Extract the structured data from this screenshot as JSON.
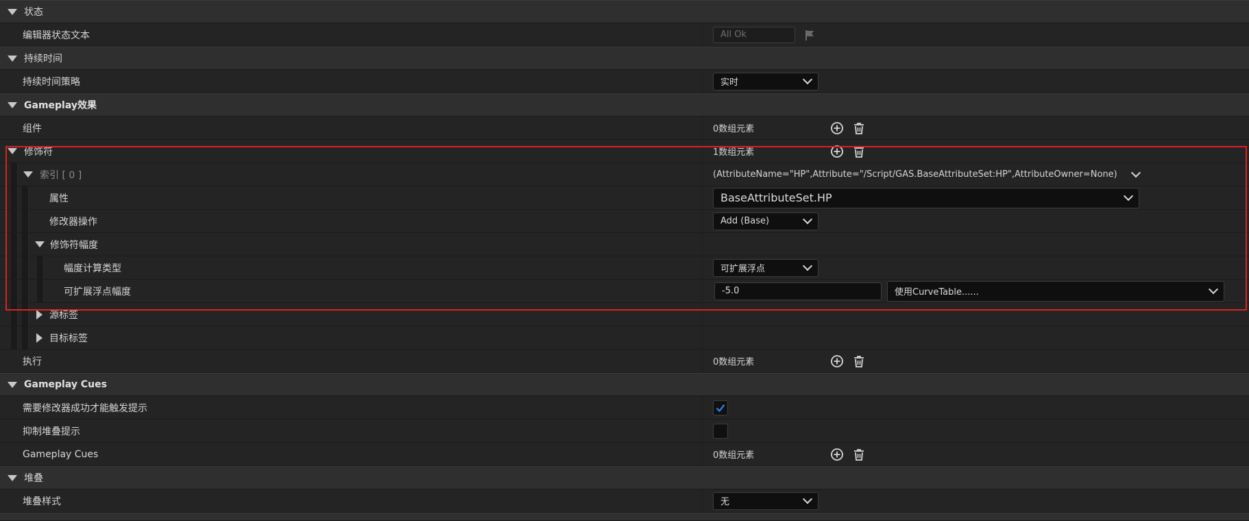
{
  "sections": {
    "state": "状态",
    "duration": "持续时间",
    "gameplay_effect": "Gameplay效果",
    "gameplay_cues": "Gameplay Cues",
    "stacking": "堆叠"
  },
  "rows": {
    "editor_status_text": {
      "label": "编辑器状态文本",
      "value": "All Ok"
    },
    "duration_policy": {
      "label": "持续时间策略",
      "value": "实时"
    },
    "components": {
      "label": "组件",
      "count": "0数组元素"
    },
    "modifiers": {
      "label": "修饰符",
      "count": "1数组元素"
    },
    "index0": {
      "label": "索引 [ 0 ]",
      "value": "(AttributeName=\"HP\",Attribute=\"/Script/GAS.BaseAttributeSet:HP\",AttributeOwner=None)"
    },
    "attribute": {
      "label": "属性",
      "value": "BaseAttributeSet.HP"
    },
    "modifier_op": {
      "label": "修改器操作",
      "value": "Add (Base)"
    },
    "modifier_magnitude": {
      "label": "修饰符幅度"
    },
    "magnitude_calc_type": {
      "label": "幅度计算类型",
      "value": "可扩展浮点"
    },
    "scalable_float_magnitude": {
      "label": "可扩展浮点幅度",
      "value": "-5.0",
      "curve_table": "使用CurveTable......"
    },
    "source_tags": {
      "label": "源标签"
    },
    "target_tags": {
      "label": "目标标签"
    },
    "executions": {
      "label": "执行",
      "count": "0数组元素"
    },
    "require_modifier_success": {
      "label": "需要修改器成功才能触发提示",
      "checked": true
    },
    "suppress_stacking_cues": {
      "label": "抑制堆叠提示",
      "checked": false
    },
    "gameplay_cues_array": {
      "label": "Gameplay Cues",
      "count": "0数组元素"
    },
    "stacking_type": {
      "label": "堆叠样式",
      "value": "无"
    }
  },
  "icons": {
    "expand": "chevron-down-icon",
    "collapse": "triangle-right-icon",
    "add": "add-circle-icon",
    "delete": "trash-icon",
    "flag": "flag-icon",
    "check": "checkmark-icon"
  },
  "colors": {
    "highlight_border": "#e02020",
    "checkmark": "#2f7de0",
    "header_bg": "#2f2f2f",
    "row_bg": "#242424"
  }
}
